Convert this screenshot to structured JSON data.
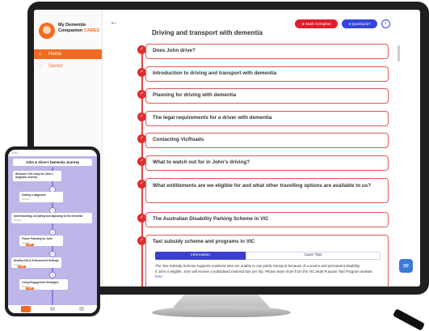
{
  "app": {
    "brand_line1": "My Dementia",
    "brand_line2": "Companion",
    "brand_cares": "CARES"
  },
  "sidebar": {
    "items": [
      {
        "label": "Home",
        "icon": "home-icon",
        "active": true
      },
      {
        "label": "Saved",
        "icon": "heart-icon",
        "active": false
      }
    ]
  },
  "header": {
    "back": "←",
    "title": "Driving and transport with dementia",
    "mark_complete": "Mark Complete",
    "questions": "Questions?",
    "info": "i"
  },
  "items": [
    {
      "label": "Does John drive?",
      "check": "✓"
    },
    {
      "label": "Introduction to driving and transport with dementia",
      "check": "✓"
    },
    {
      "label": "Planning for driving with dementia",
      "check": "✓"
    },
    {
      "label": "The legal requirements for a driver with dementia",
      "check": "✓"
    },
    {
      "label": "Contacting VicRoads",
      "check": "✓"
    },
    {
      "label": "What to watch out for in John's driving?",
      "check": "✓"
    },
    {
      "label": "What entitlements are we eligible for and what other travelling options are available to us?",
      "check": "✓"
    },
    {
      "label": "The Australian Disability Parking Scheme in VIC",
      "check": "✓"
    },
    {
      "label": "Taxi subsidy scheme and programs in VIC",
      "check": "✓"
    }
  ],
  "open_item": {
    "tab_info": "Information",
    "tab_carer": "Carer Tips",
    "para1": "The Taxi Subsidy Scheme supports residents who are unable to use public transport because of a severe and permanent disability.",
    "para2": "If John is eligible, John will receive a subsidised metered fare per trip. Please learn more from the VIC Multi Purpose Taxi Program website",
    "link": "here."
  },
  "chat_icon": "chat-icon",
  "phone": {
    "status": "9:41",
    "title": "John & Alice's Dementia Journey",
    "cards": [
      {
        "label": "Welcome! Get ready for John's dementia Journey",
        "sub": "5 topics",
        "num": "1"
      },
      {
        "label": "Getting a diagnosis",
        "sub": "6 topics",
        "num": "2"
      },
      {
        "label": "Understanding, accepting and adjusting to the dementia",
        "sub": "8 topics",
        "num": "3"
      },
      {
        "label": "Future Planning for John",
        "sub": "4 topics",
        "num": "4"
      },
      {
        "label": "Healthy Diet & Environment Settings",
        "sub": "5 topics",
        "num": "5"
      },
      {
        "label": "Living Engagement Strategies",
        "sub": "6 topics",
        "num": "6"
      }
    ],
    "tag": "NEW"
  },
  "colors": {
    "accent": "#f26b21",
    "alert": "#e11d2a",
    "primary": "#3446d8",
    "phone_bg": "#bdb6e8"
  }
}
